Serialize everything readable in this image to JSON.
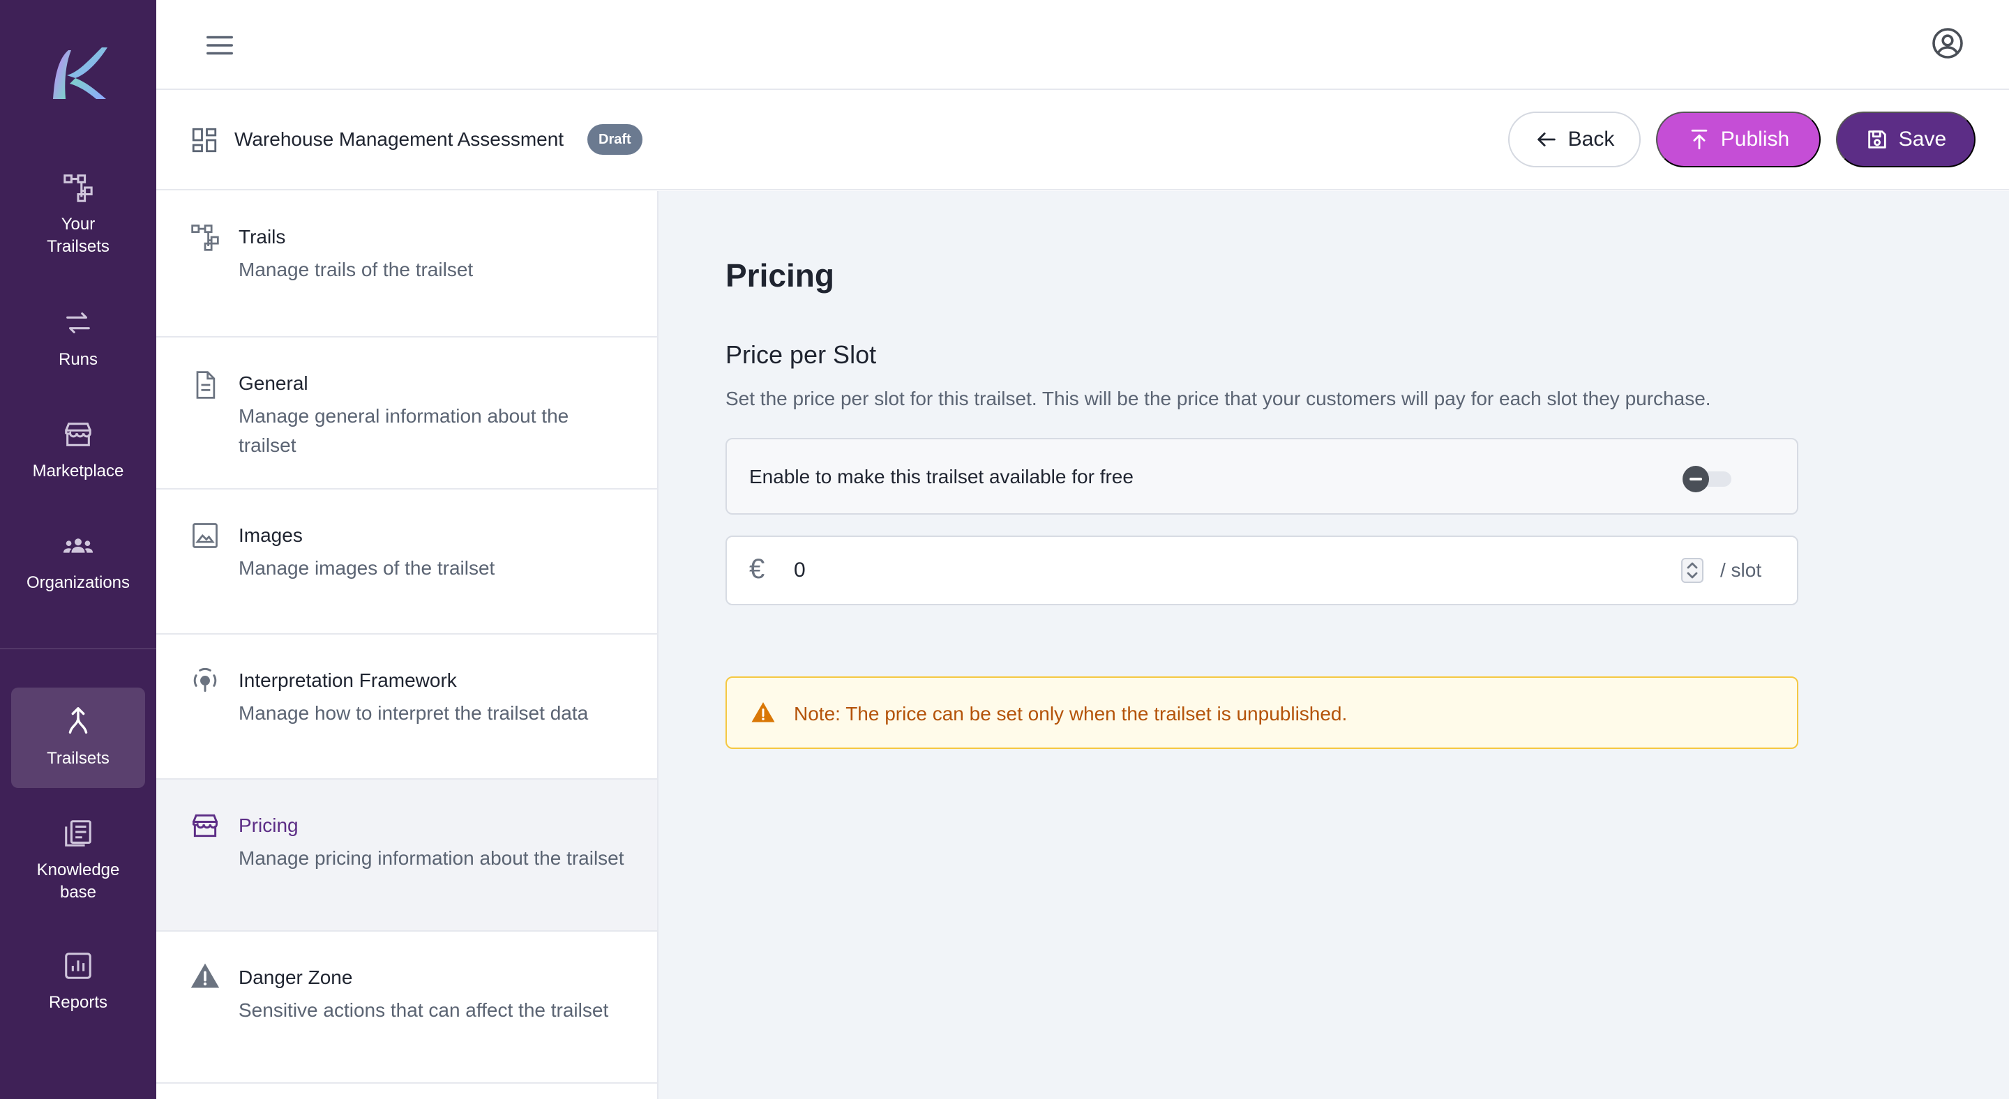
{
  "rail": {
    "items": [
      {
        "id": "your-trailsets",
        "label": "Your Trailsets",
        "icon": "hierarchy-icon"
      },
      {
        "id": "runs",
        "label": "Runs",
        "icon": "repeat-icon"
      },
      {
        "id": "marketplace",
        "label": "Marketplace",
        "icon": "storefront-icon"
      },
      {
        "id": "organizations",
        "label": "Organizations",
        "icon": "people-icon"
      },
      {
        "id": "trailsets",
        "label": "Trailsets",
        "icon": "merge-icon",
        "active": true
      },
      {
        "id": "knowledge-base",
        "label": "Knowledge base",
        "icon": "library-icon"
      },
      {
        "id": "reports",
        "label": "Reports",
        "icon": "bar-chart-icon"
      }
    ]
  },
  "header": {
    "title": "Warehouse Management Assessment",
    "badge": "Draft",
    "back_label": "Back",
    "publish_label": "Publish",
    "save_label": "Save"
  },
  "settings_nav": {
    "items": [
      {
        "title": "Trails",
        "desc": "Manage trails of the trailset",
        "icon": "hierarchy-icon"
      },
      {
        "title": "General",
        "desc": "Manage general information about the trailset",
        "icon": "document-icon"
      },
      {
        "title": "Images",
        "desc": "Manage images of the trailset",
        "icon": "image-icon"
      },
      {
        "title": "Interpretation Framework",
        "desc": "Manage how to interpret the trailset data",
        "icon": "interpretation-icon"
      },
      {
        "title": "Pricing",
        "desc": "Manage pricing information about the trailset",
        "icon": "storefront-icon",
        "selected": true
      },
      {
        "title": "Danger Zone",
        "desc": "Sensitive actions that can affect the trailset",
        "icon": "warning-icon"
      }
    ]
  },
  "main": {
    "title": "Pricing",
    "subheading": "Price per Slot",
    "helper": "Set the price per slot for this trailset. This will be the price that your customers will pay for each slot they purchase.",
    "free_toggle_label": "Enable to make this trailset available for free",
    "free_toggle_on": false,
    "currency_symbol": "€",
    "price_value": "0",
    "unit_label": "/ slot",
    "note": "Note: The price can be set only when the trailset is unpublished."
  },
  "colors": {
    "rail_bg": "#3f2157",
    "publish": "#c54ed6",
    "save": "#5c2d86",
    "note_bg": "#fffbea",
    "note_border": "#f5c842",
    "note_text": "#b45309"
  }
}
